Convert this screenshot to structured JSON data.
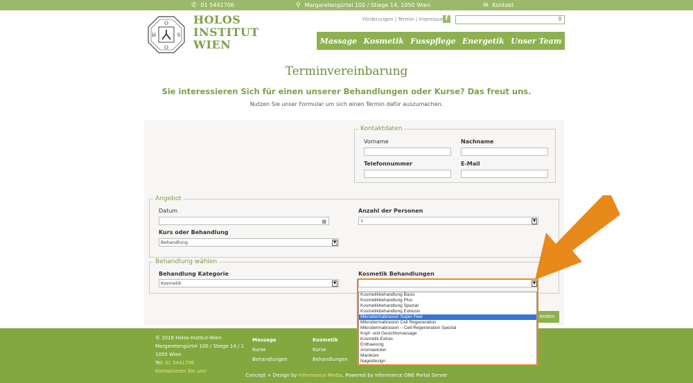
{
  "topbar": {
    "phone": "01 5441706",
    "address": "Margaretengürtel 100 / Stiege 14, 1050 Wien",
    "contact": "Kontakt"
  },
  "header": {
    "brand_line1": "HOLOS",
    "brand_line2": "INSTITUT",
    "brand_line3": "WIEN",
    "toplinks": [
      "Förderungen",
      "Termin",
      "Impressum"
    ],
    "search_placeholder": "",
    "nav": [
      "Massage",
      "Kosmetik",
      "Fusspflege",
      "Energetik",
      "Unser Team"
    ]
  },
  "intro": {
    "title": "Terminvereinbarung",
    "subtitle": "Sie interessieren Sich für einen unserer Behandlungen oder Kurse? Das freut uns.",
    "text": "Nutzen Sie unser Formular um sich einen Termin dafür auszumachen."
  },
  "contact": {
    "legend": "Kontaktdaten",
    "vorname": "Vorname",
    "nachname": "Nachname",
    "telefon": "Telefonnummer",
    "email": "E-Mail"
  },
  "angebot": {
    "legend": "Angebot",
    "datum": "Datum",
    "personen_label": "Anzahl der Personen",
    "personen_value": "1",
    "kurs_label": "Kurs oder Behandlung",
    "kurs_value": "Behandlung"
  },
  "behandlung": {
    "legend": "Behandlung wählen",
    "kategorie_label": "Behandlung Kategorie",
    "kategorie_value": "Kosmetik",
    "kosmetik_label": "Kosmetik Behandlungen",
    "kosmetik_value": "",
    "options": [
      "Kosmetikbehandlung Basis",
      "Kosmetikbehandlung Plus",
      "Kosmetikbehandlung Spezial",
      "Kosmetikbehandlung Exklusiv",
      "Mikrodermabrasion Super Peel",
      "Mikrodermabrasion Cell Regeneration",
      "Mikrodermabrasion – Cell-Regeneration Spezial",
      "Kopf- und Gesichtsmassage",
      "Kosmetik Extras",
      "Enthaarung",
      "Aromawickel",
      "Maniküre",
      "Nageldesign"
    ],
    "selected_index": 4
  },
  "submit_label": "enden",
  "footer": {
    "copyright": "© 2016 Holos-Institut-Wien",
    "address1": "Margaretengürtel 100 / Stiege 14 / 1",
    "address2": "1050 Wien",
    "tel_label": "Tel:",
    "tel": "01 5441706",
    "contact_cta": "Kontaktieren Sie uns!",
    "col1_head": "Massage",
    "col1_items": [
      "Kurse",
      "Behandlungen"
    ],
    "col2_head": "Kosmetik",
    "col2_items": [
      "Kurse",
      "Behandlungen"
    ],
    "credits_pre": "Concept + Design by",
    "credits_link": "Informance Media",
    "credits_post": ", Powered by Informance ONE Portal Server"
  },
  "colors": {
    "green": "#8db14f",
    "topbar": "#9bb96a",
    "accent_orange": "#e8891b",
    "selection_blue": "#3874d8"
  }
}
